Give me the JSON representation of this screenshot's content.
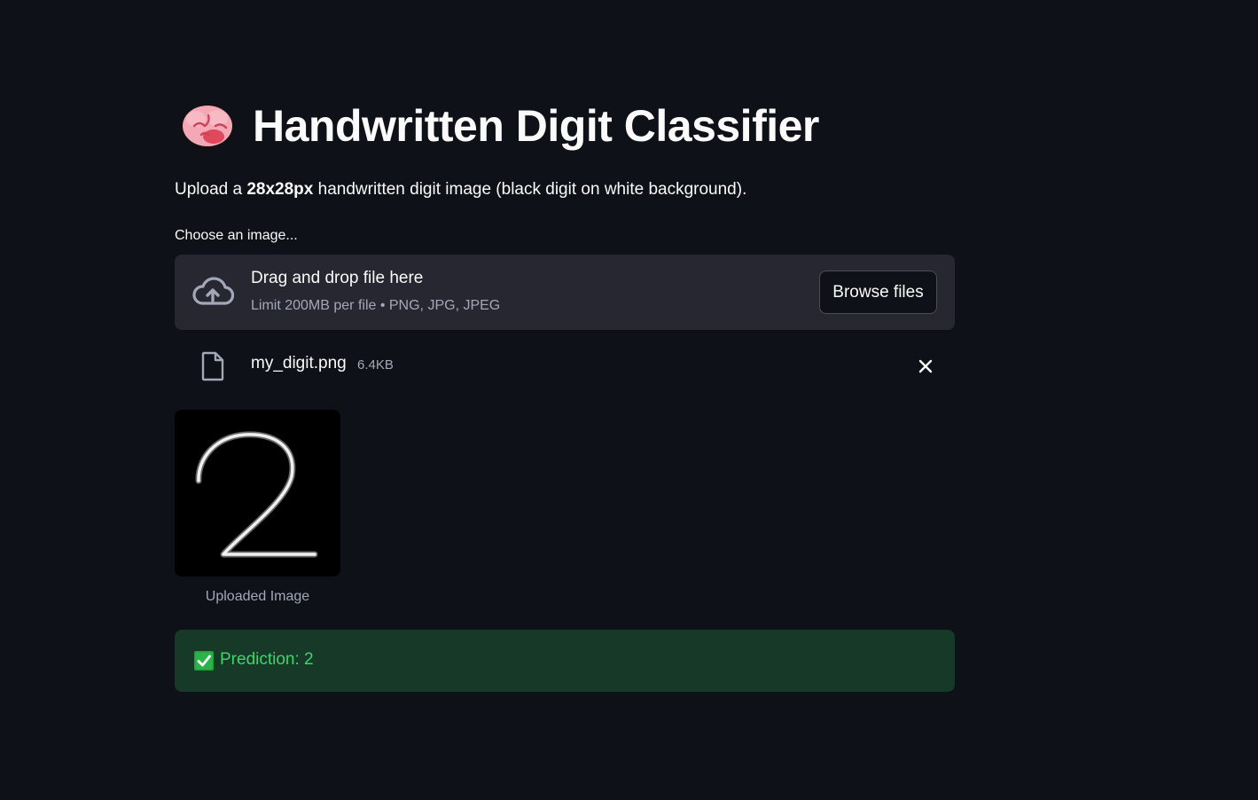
{
  "header": {
    "title": "Handwritten Digit Classifier",
    "emoji": "brain-icon"
  },
  "intro": {
    "prefix": "Upload a ",
    "bold": "28x28px",
    "suffix": " handwritten digit image (black digit on white background)."
  },
  "uploader": {
    "label": "Choose an image...",
    "drop_text": "Drag and drop file here",
    "limit_text": "Limit 200MB per file • PNG, JPG, JPEG",
    "browse_label": "Browse files",
    "upload_icon": "cloud-upload-icon"
  },
  "file": {
    "name": "my_digit.png",
    "size": "6.4KB",
    "icon": "file-icon",
    "remove_icon": "close-icon"
  },
  "image": {
    "caption": "Uploaded Image",
    "digit": "2"
  },
  "result": {
    "text": "Prediction: 2",
    "icon": "check-box-icon",
    "color": "#3dd56d",
    "background": "#173928"
  },
  "colors": {
    "background": "#0e1117",
    "panel": "#262730",
    "text": "#fafafa",
    "muted": "#a3a8b8"
  }
}
